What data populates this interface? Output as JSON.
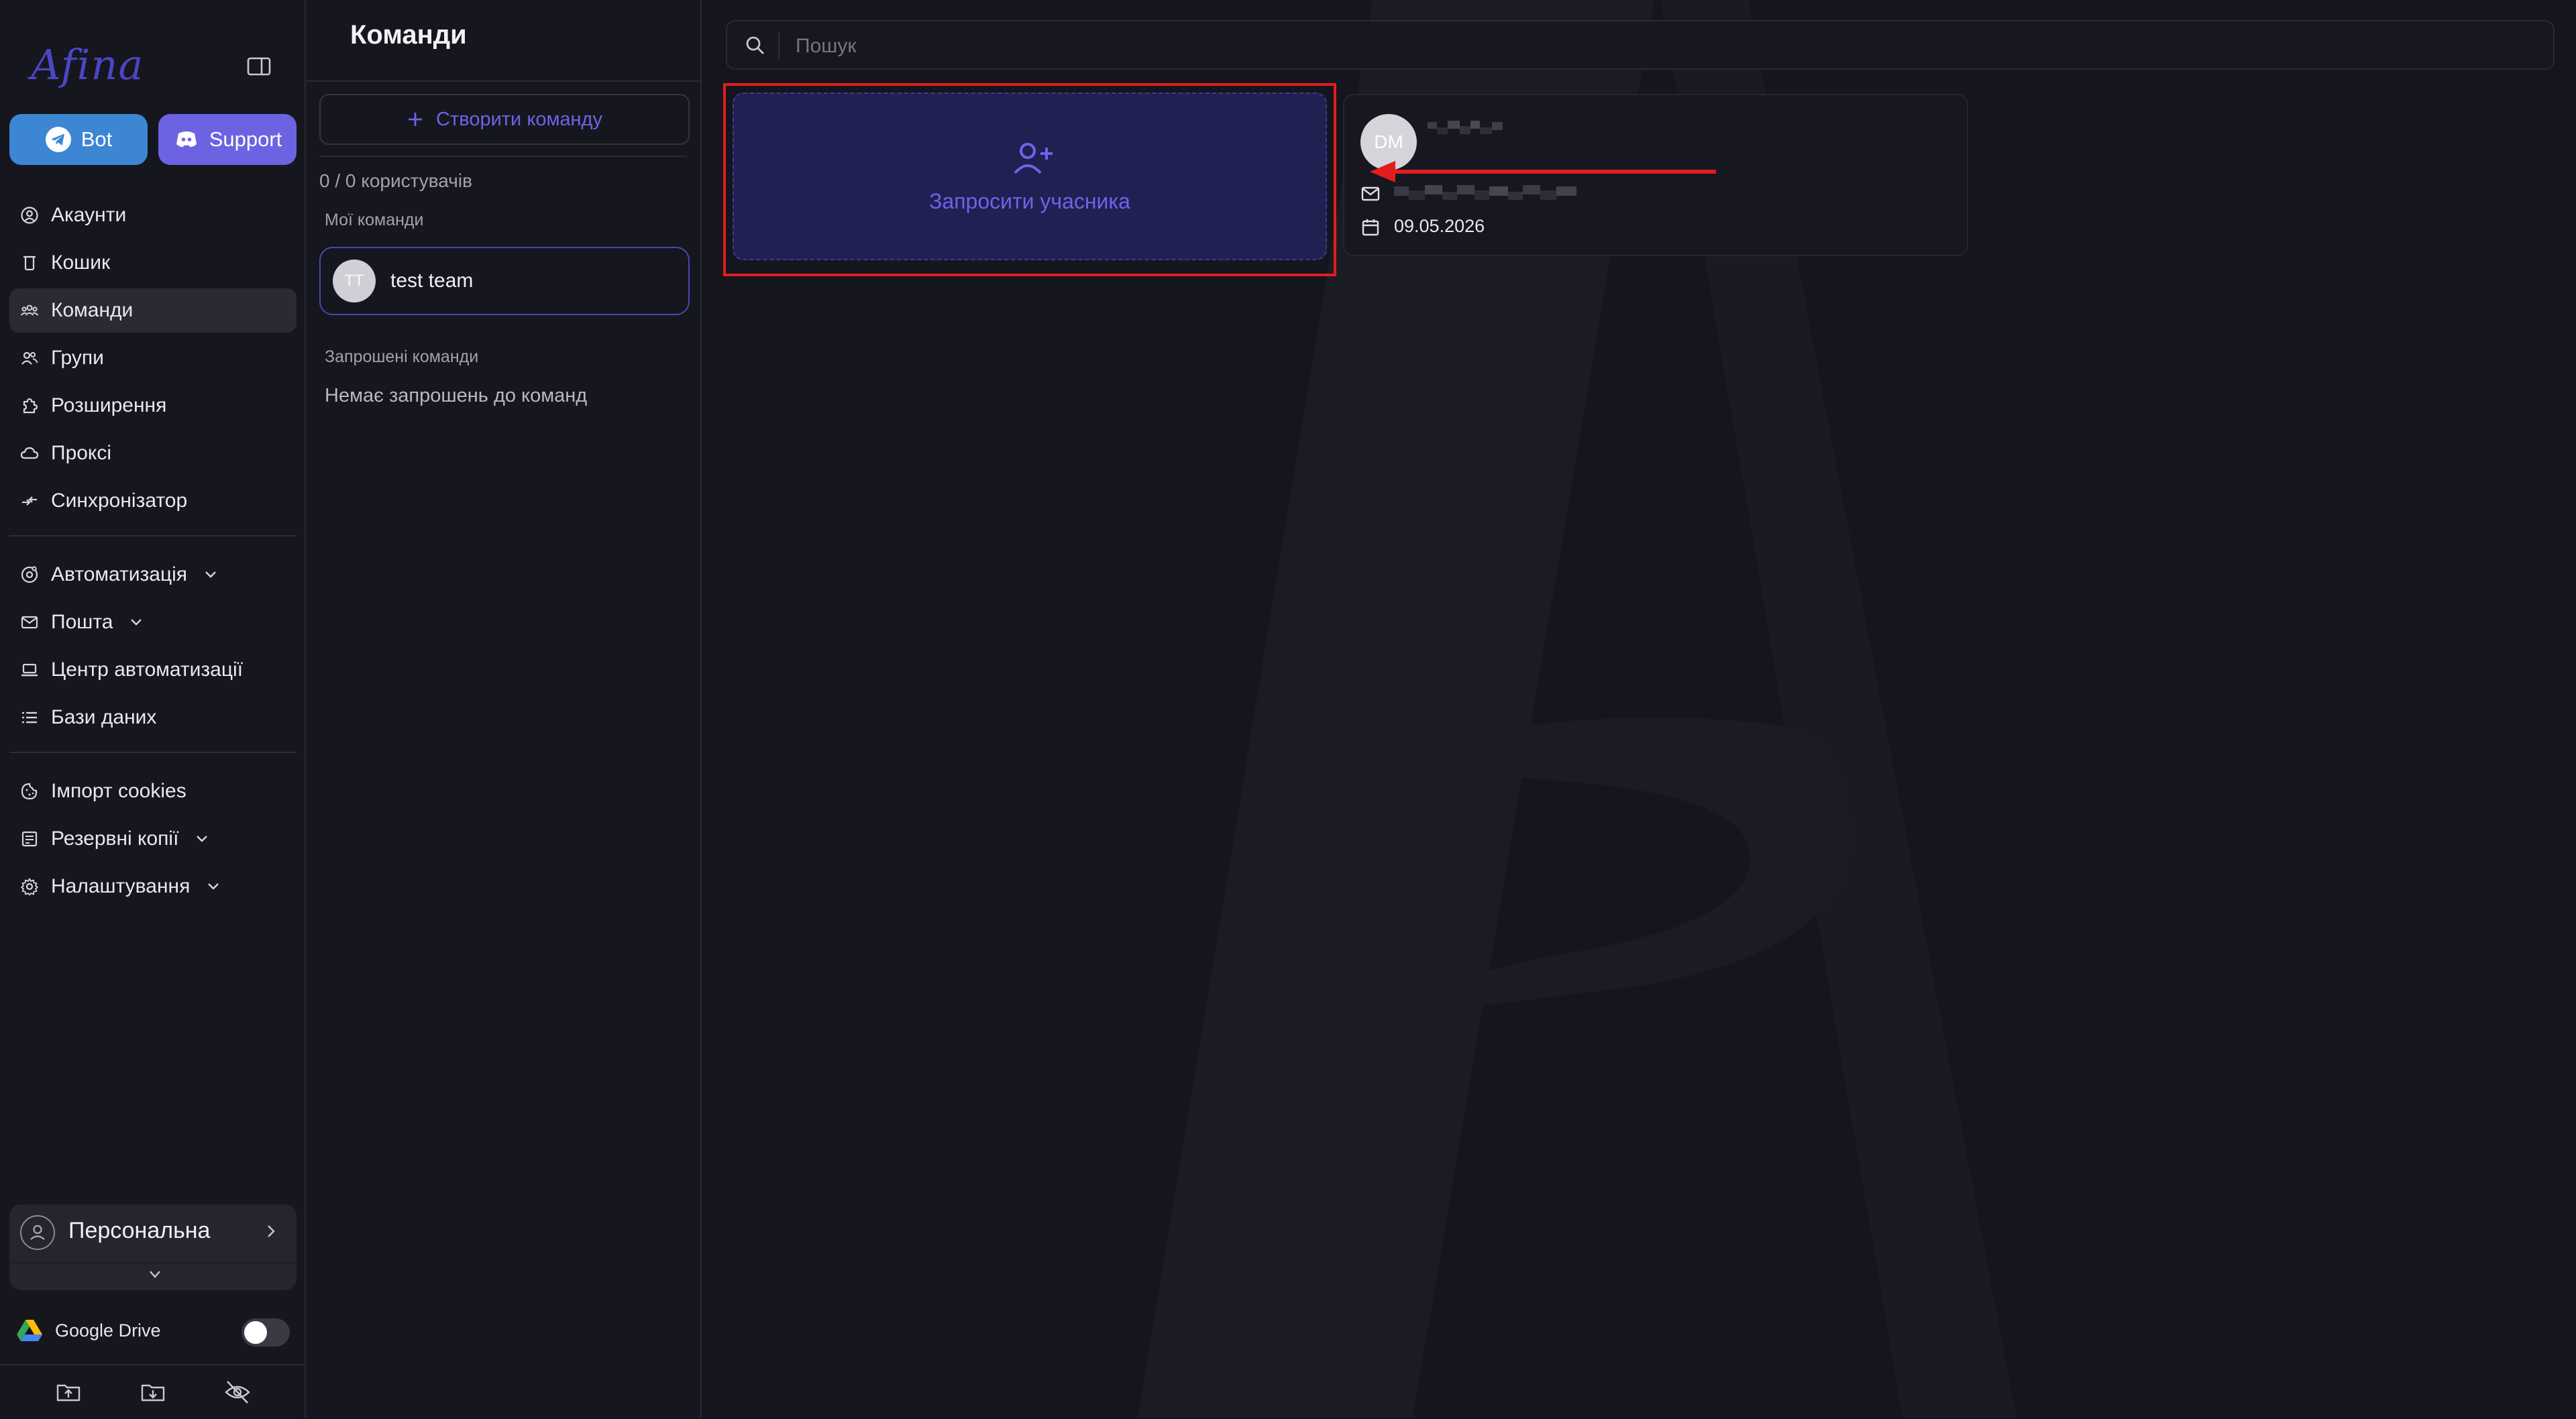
{
  "window": {
    "traffic_lights": [
      "#ff5f57",
      "#febc2e",
      "#28c840"
    ]
  },
  "sidebar": {
    "logo": "Afina",
    "bot_label": "Bot",
    "support_label": "Support",
    "nav_group1": [
      {
        "label": "Акаунти",
        "icon": "user-circle-icon"
      },
      {
        "label": "Кошик",
        "icon": "trash-icon"
      },
      {
        "label": "Команди",
        "icon": "team-icon",
        "active": true
      },
      {
        "label": "Групи",
        "icon": "users-icon"
      },
      {
        "label": "Розширення",
        "icon": "puzzle-icon"
      },
      {
        "label": "Проксі",
        "icon": "cloud-icon"
      },
      {
        "label": "Синхронізатор",
        "icon": "sync-icon"
      }
    ],
    "nav_group2": [
      {
        "label": "Автоматизація",
        "icon": "automation-icon",
        "dropdown": true
      },
      {
        "label": "Пошта",
        "icon": "mail-icon",
        "dropdown": true
      },
      {
        "label": "Центр автоматизації",
        "icon": "laptop-icon"
      },
      {
        "label": "Бази даних",
        "icon": "list-icon"
      }
    ],
    "nav_group3": [
      {
        "label": "Імпорт cookies",
        "icon": "cookie-icon"
      },
      {
        "label": "Резервні копії",
        "icon": "backup-icon",
        "dropdown": true
      },
      {
        "label": "Налаштування",
        "icon": "gear-icon",
        "dropdown": true
      }
    ],
    "workspace_label": "Персональна",
    "google_drive_label": "Google Drive",
    "google_drive_enabled": false
  },
  "teams_panel": {
    "title": "Команди",
    "create_button": "Створити команду",
    "users_count": "0 / 0 користувачів",
    "my_teams_label": "Мої команди",
    "my_teams": [
      {
        "initials": "TT",
        "name": "test team"
      }
    ],
    "invited_label": "Запрошені команди",
    "no_invites": "Немає запрошень до команд"
  },
  "main": {
    "search_placeholder": "Пошук",
    "invite_label": "Запросити учасника",
    "member": {
      "initials": "DM",
      "date": "09.05.2026"
    }
  },
  "colors": {
    "accent": "#6c63e3",
    "highlight_frame": "#e11d1d",
    "bot": "#3d86d4"
  }
}
